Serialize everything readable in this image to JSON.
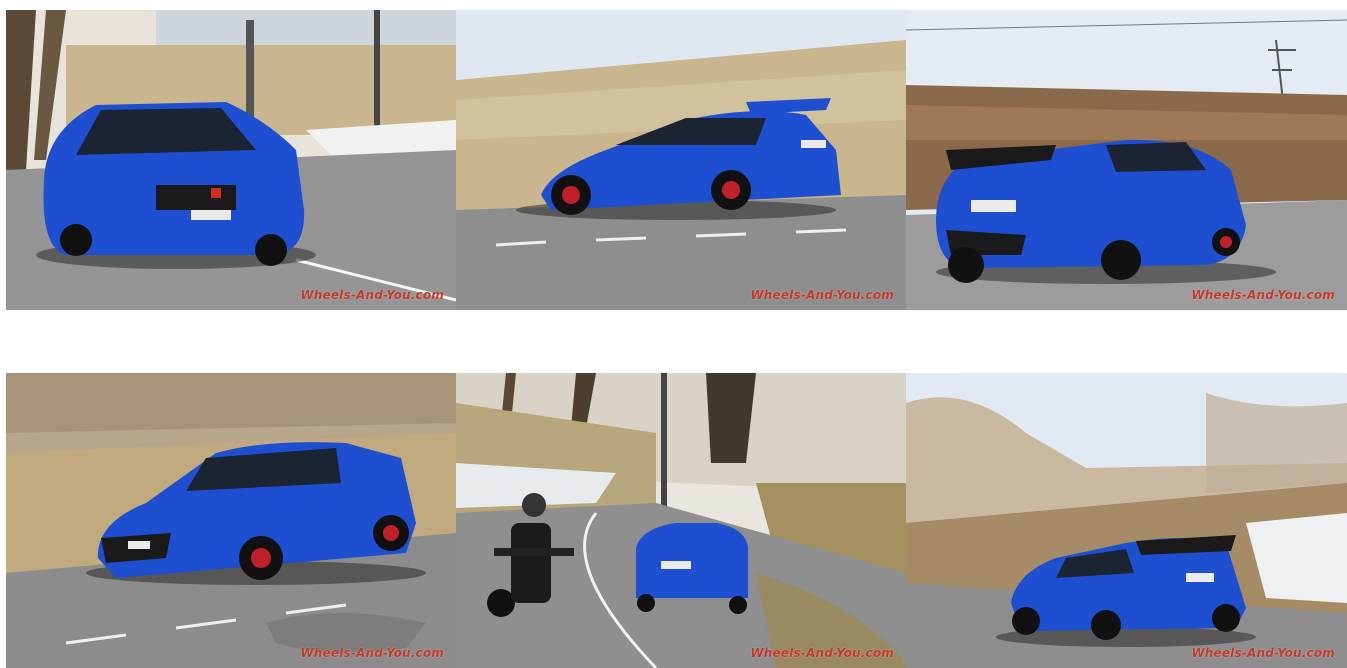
{
  "gallery": {
    "photos": [
      {
        "subject": "front-three-quarter",
        "watermark": "Wheels-And-You.com"
      },
      {
        "subject": "side-profile-motion",
        "watermark": "Wheels-And-You.com"
      },
      {
        "subject": "rear-three-quarter",
        "watermark": "Wheels-And-You.com"
      },
      {
        "subject": "front-side-motion",
        "watermark": "Wheels-And-You.com"
      },
      {
        "subject": "motorcycle-and-car-on-curve",
        "watermark": "Wheels-And-You.com"
      },
      {
        "subject": "rear-on-hillside-road",
        "watermark": "Wheels-And-You.com"
      }
    ],
    "colors": {
      "car_blue": "#1f4fd1",
      "watermark_red": "#c0392b",
      "asphalt": "#8f8f8f",
      "grass": "#b9a77a",
      "sky": "#dfe8f1"
    }
  }
}
